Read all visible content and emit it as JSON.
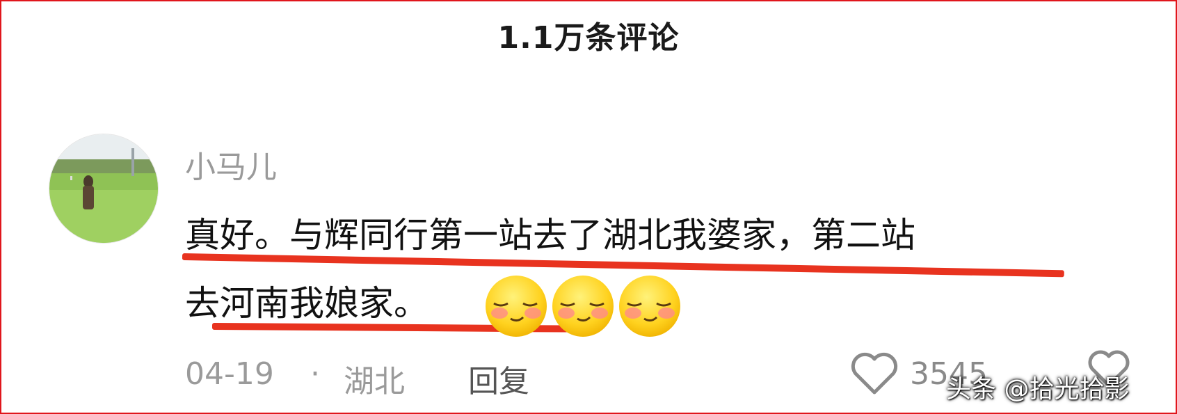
{
  "header": {
    "title": "1.1万条评论"
  },
  "comment": {
    "username": "小马儿",
    "text_line1": "真好。与辉同行第一站去了湖北我婆家，第二站",
    "text_line2": "去河南我娘家。",
    "emojis": [
      "shy-smile-emoji",
      "shy-smile-emoji",
      "shy-smile-emoji"
    ],
    "date": "04-19",
    "separator": "·",
    "location": "湖北",
    "reply_label": "回复",
    "like_count": "3545"
  },
  "watermark": {
    "text": "头条 @拾光拾影"
  },
  "colors": {
    "annotation_red": "#e8331f",
    "frame_red": "#e0161c",
    "muted_text": "#9a9a9a"
  }
}
